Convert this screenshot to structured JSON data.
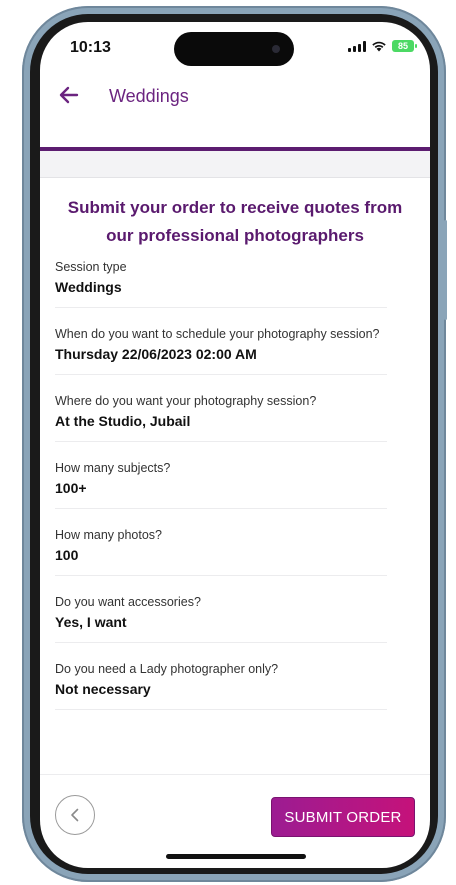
{
  "status": {
    "time": "10:13",
    "battery": "85"
  },
  "header": {
    "title": "Weddings"
  },
  "headline": "Submit your order to receive quotes from our professional photographers",
  "fields": [
    {
      "label": "Session type",
      "value": "Weddings"
    },
    {
      "label": "When do you want to schedule your photography session?",
      "value": "Thursday 22/06/2023 02:00 AM"
    },
    {
      "label": "Where do you want your photography session?",
      "value": "At the Studio,  Jubail"
    },
    {
      "label": "How many subjects?",
      "value": "100+"
    },
    {
      "label": "How many photos?",
      "value": "100"
    },
    {
      "label": "Do you want accessories?",
      "value": "Yes, I want"
    },
    {
      "label": "Do you need a Lady photographer only?",
      "value": "Not necessary"
    }
  ],
  "footer": {
    "submit_label": "SUBMIT ORDER"
  },
  "colors": {
    "brand": "#6b2480",
    "button_start": "#9c1c92",
    "button_end": "#c5127a"
  }
}
